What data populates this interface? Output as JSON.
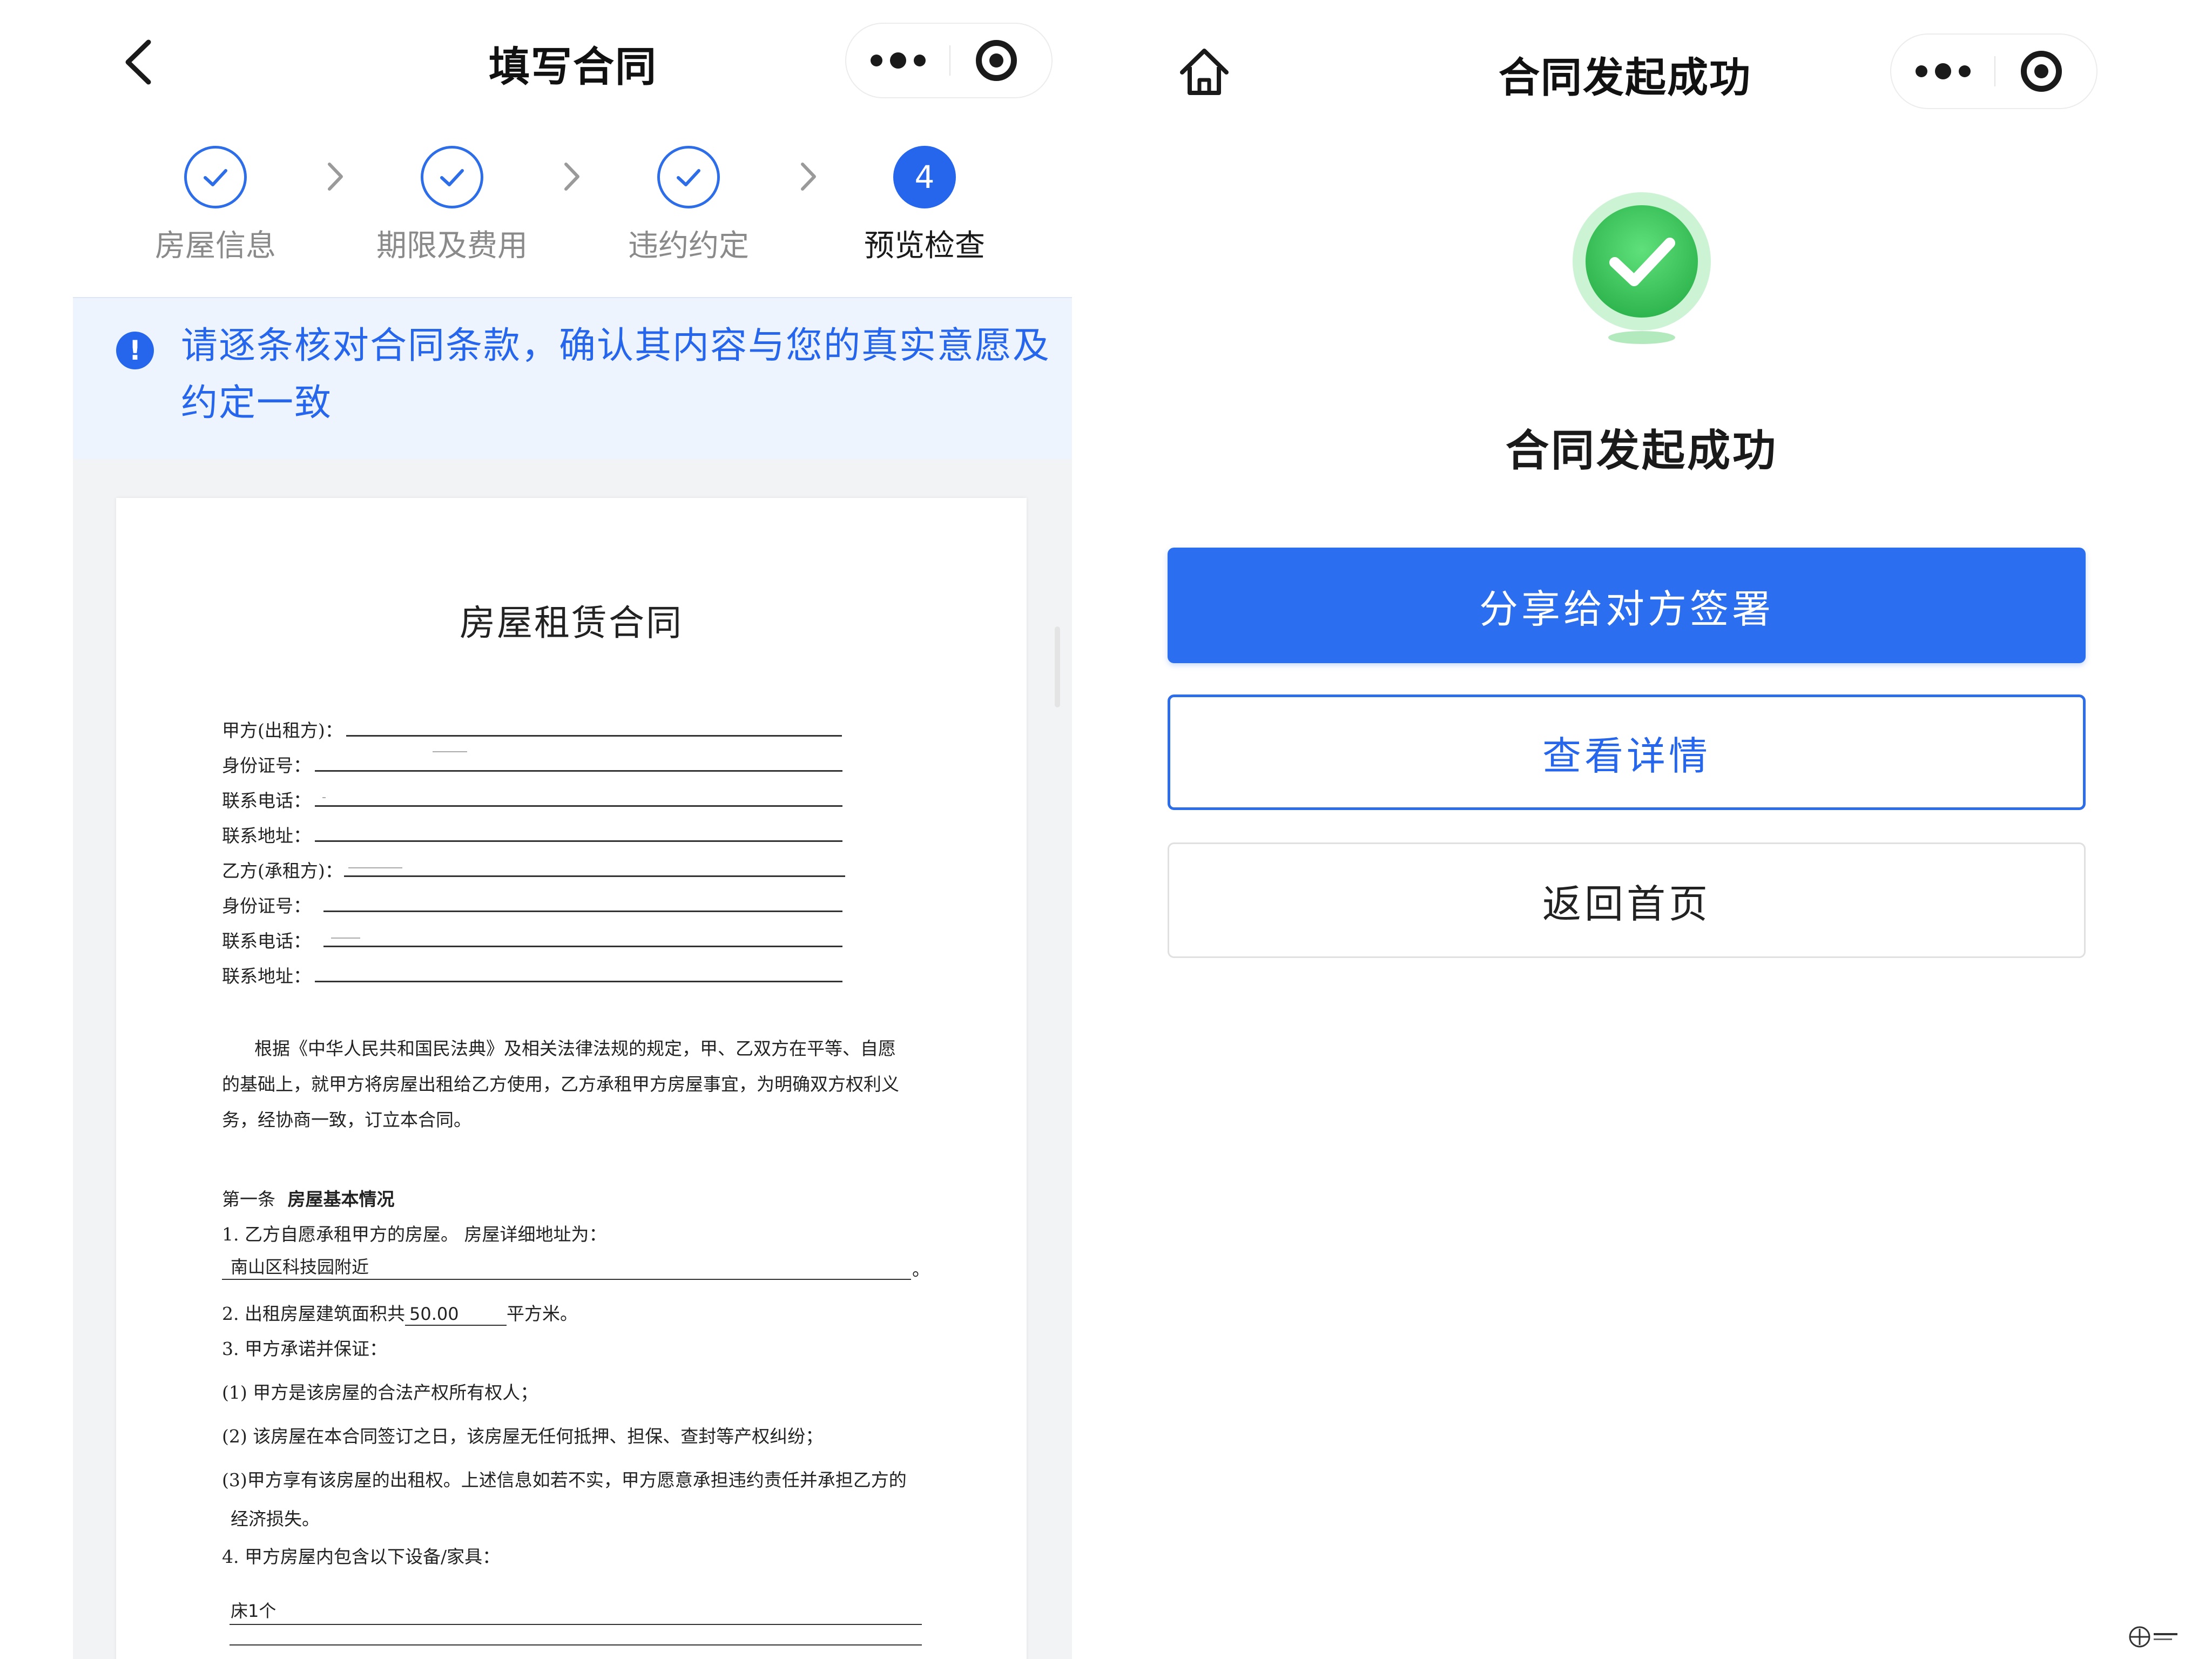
{
  "left": {
    "header": {
      "title": "填写合同"
    },
    "steps": [
      {
        "label": "房屋信息",
        "state": "done"
      },
      {
        "label": "期限及费用",
        "state": "done"
      },
      {
        "label": "违约约定",
        "state": "done"
      },
      {
        "label": "预览检查",
        "state": "active",
        "number": "4"
      }
    ],
    "notice": {
      "text": "请逐条核对合同条款，确认其内容与您的真实意愿及约定一致"
    },
    "document": {
      "title": "房屋租赁合同",
      "party_fields": [
        "甲方(出租方)：",
        "身份证号：",
        "联系电话：",
        "联系地址：",
        "乙方(承租方)：",
        "身份证号：",
        "联系电话：",
        "联系地址："
      ],
      "preamble": [
        "根据《中华人民共和国民法典》及相关法律法规的规定，甲、乙双方在平等、自愿",
        "的基础上，就甲方将房屋出租给乙方使用，乙方承租甲方房屋事宜，为明确双方权利义",
        "务，经协商一致，订立本合同。"
      ],
      "article1": {
        "prefix": "第一条",
        "heading": "房屋基本情况",
        "item1": "1. 乙方自愿承租甲方的房屋。 房屋详细地址为：",
        "address": "南山区科技园附近",
        "address_end": "。",
        "item2_prefix": "2. 出租房屋建筑面积共",
        "area": "50.00",
        "item2_suffix": "平方米。",
        "item3": "3. 甲方承诺并保证：",
        "item3_1": "(1) 甲方是该房屋的合法产权所有权人；",
        "item3_2": "(2) 该房屋在本合同签订之日，该房屋无任何抵押、担保、查封等产权纠纷；",
        "item3_3a": "(3)甲方享有该房屋的出租权。上述信息如若不实，甲方愿意承担违约责任并承担乙方的",
        "item3_3b": "经济损失。",
        "item4": "4. 甲方房屋内包含以下设备/家具：",
        "furniture": "床1个"
      }
    }
  },
  "right": {
    "header": {
      "title": "合同发起成功"
    },
    "success_title": "合同发起成功",
    "buttons": {
      "share": "分享给对方签署",
      "details": "查看详情",
      "home": "返回首页"
    }
  },
  "colors": {
    "primary_blue": "#2566ec",
    "notice_bg": "#eef4fd",
    "success_green": "#3fc75d"
  }
}
